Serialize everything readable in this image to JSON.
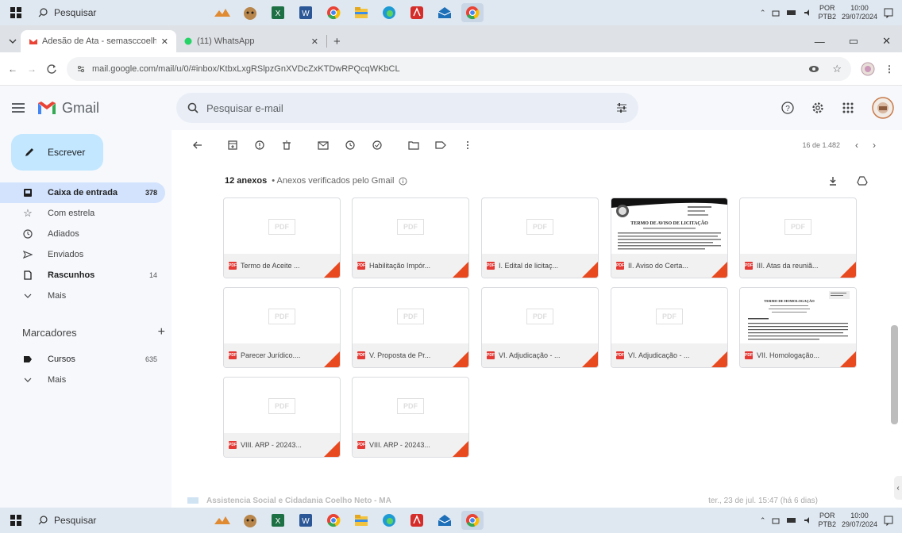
{
  "taskbar": {
    "search_placeholder": "Pesquisar",
    "language_top": "POR",
    "language_bottom": "PTB2",
    "time": "10:00",
    "date": "29/07/2024",
    "apps": [
      "photos",
      "cat",
      "excel",
      "word",
      "chrome",
      "files",
      "edge",
      "pdf",
      "mail",
      "chrome-profile"
    ]
  },
  "browser": {
    "tabs": [
      {
        "title": "Adesão de Ata - semasccoelhon",
        "icon": "gmail-icon",
        "active": true
      },
      {
        "title": "(11) WhatsApp",
        "icon": "whatsapp-icon",
        "active": false
      }
    ],
    "new_tab": "+",
    "url": "mail.google.com/mail/u/0/#inbox/KtbxLxgRSlpzGnXVDcZxKTDwRPQcqWKbCL"
  },
  "gmail": {
    "brand": "Gmail",
    "search_placeholder": "Pesquisar e-mail",
    "compose_label": "Escrever",
    "nav": [
      {
        "label": "Caixa de entrada",
        "count": "378",
        "icon": "inbox-icon",
        "selected": true
      },
      {
        "label": "Com estrela",
        "count": "",
        "icon": "star-icon"
      },
      {
        "label": "Adiados",
        "count": "",
        "icon": "clock-icon"
      },
      {
        "label": "Enviados",
        "count": "",
        "icon": "send-icon"
      },
      {
        "label": "Rascunhos",
        "count": "14",
        "icon": "draft-icon",
        "bold": true
      },
      {
        "label": "Mais",
        "count": "",
        "icon": "chevron-down-icon"
      }
    ],
    "labels_title": "Marcadores",
    "labels": [
      {
        "label": "Cursos",
        "count": "635",
        "icon": "label-icon"
      },
      {
        "label": "Mais",
        "count": "",
        "icon": "chevron-down-icon"
      }
    ],
    "pagination": "16 de 1.482",
    "attachments_count": "12 anexos",
    "attachments_note": "• Anexos verificados pelo Gmail",
    "attachments": [
      "Termo de Aceite ...",
      "Habilitação Impór...",
      "I. Edital de licitaç...",
      "II. Aviso do Certa...",
      "III. Atas da reuniã...",
      "Parecer Jurídico....",
      "V. Proposta de Pr...",
      "VI. Adjudicação - ...",
      "VI. Adjudicação - ...",
      "VII. Homologação...",
      "VIII. ARP - 20243...",
      "VIII. ARP - 20243..."
    ],
    "thumb_text": "PDF",
    "doc1_title": "TERMO DE AVISO DE LICITAÇÃO",
    "doc2_title": "TERMO DE HOMOLOGAÇÃO",
    "next_mail_sender": "Assistencia Social e Cidadania Coelho Neto - MA",
    "next_mail_meta": "ter., 23 de jul. 15:47 (há 6 dias)"
  }
}
